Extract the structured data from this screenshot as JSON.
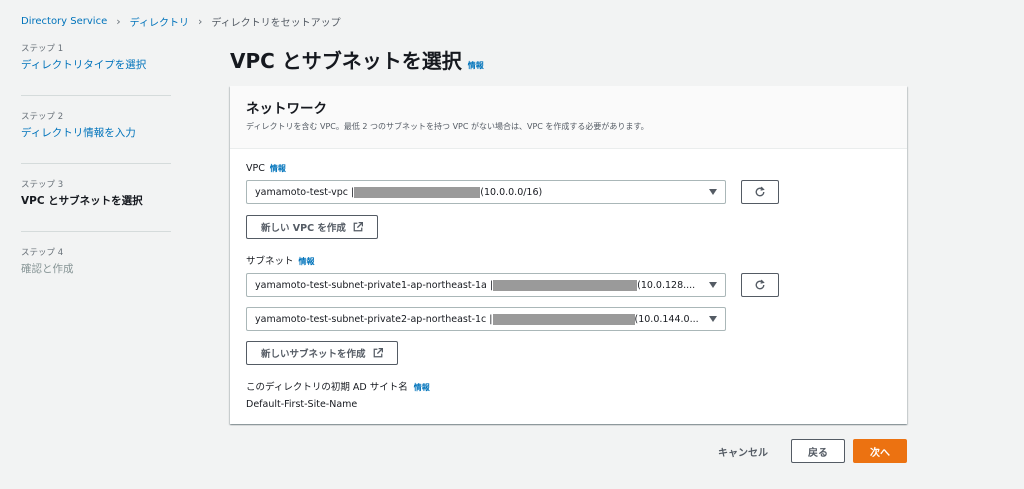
{
  "breadcrumb": {
    "items": [
      "Directory Service",
      "ディレクトリ",
      "ディレクトリをセットアップ"
    ]
  },
  "steps": [
    {
      "number": "ステップ 1",
      "title": "ディレクトリタイプを選択",
      "state": "link"
    },
    {
      "number": "ステップ 2",
      "title": "ディレクトリ情報を入力",
      "state": "link"
    },
    {
      "number": "ステップ 3",
      "title": "VPC とサブネットを選択",
      "state": "current"
    },
    {
      "number": "ステップ 4",
      "title": "確認と作成",
      "state": "disabled"
    }
  ],
  "page": {
    "title": "VPC とサブネットを選択",
    "info": "情報"
  },
  "panel": {
    "title": "ネットワーク",
    "description": "ディレクトリを含む VPC。最低 2 つのサブネットを持つ VPC がない場合は、VPC を作成する必要があります。"
  },
  "vpc": {
    "label": "VPC",
    "info": "情報",
    "selected_prefix": "yamamoto-test-vpc | ",
    "selected_suffix": "(10.0.0.0/16)",
    "create_button": "新しい VPC を作成"
  },
  "subnet": {
    "label": "サブネット",
    "info": "情報",
    "subnet1_prefix": "yamamoto-test-subnet-private1-ap-northeast-1a | ",
    "subnet1_suffix": "(10.0.128....",
    "subnet2_prefix": "yamamoto-test-subnet-private2-ap-northeast-1c | ",
    "subnet2_suffix": "(10.0.144.0...",
    "create_button": "新しいサブネットを作成"
  },
  "site": {
    "label": "このディレクトリの初期 AD サイト名",
    "info": "情報",
    "value": "Default-First-Site-Name"
  },
  "footer": {
    "cancel": "キャンセル",
    "back": "戻る",
    "next": "次へ"
  },
  "colors": {
    "link": "#0073bb",
    "primary": "#ec7211",
    "background": "#f2f3f3",
    "redaction": "#9a9a9a"
  }
}
